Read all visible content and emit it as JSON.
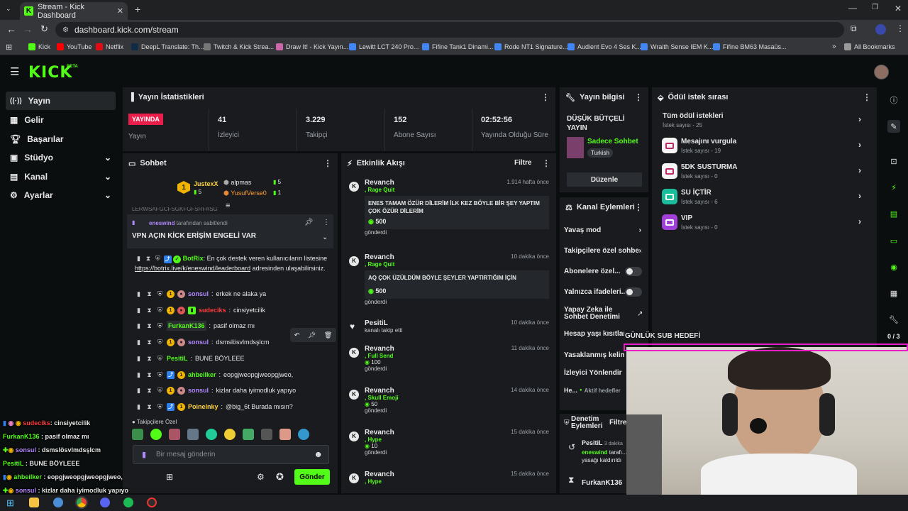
{
  "browser": {
    "tab_title": "Stream - Kick Dashboard",
    "url": "dashboard.kick.com/stream",
    "bookmarks": [
      "Kick",
      "YouTube",
      "Netflix",
      "DeepL Translate: Th...",
      "Twitch & Kick Strea...",
      "Draw It! - Kick Yayın...",
      "Lewitt LCT 240 Pro...",
      "Fifine Tank1 Dinami...",
      "Rode NT1 Signature...",
      "Audient Evo 4 Ses K...",
      "Wraith Sense IEM K...",
      "Fifine BM63 Masaüs..."
    ],
    "all_bookmarks": "All Bookmarks"
  },
  "brand": {
    "logo": "KICK",
    "beta": "BETA"
  },
  "sidebar": {
    "items": [
      {
        "label": "Yayın",
        "icon": "broadcast-icon"
      },
      {
        "label": "Gelir",
        "icon": "revenue-icon"
      },
      {
        "label": "Başarılar",
        "icon": "trophy-icon"
      },
      {
        "label": "Stüdyo",
        "icon": "studio-icon"
      },
      {
        "label": "Kanal",
        "icon": "channel-icon"
      },
      {
        "label": "Ayarlar",
        "icon": "settings-icon"
      }
    ]
  },
  "stats": {
    "title": "Yayın İstatistikleri",
    "live_badge": "YAYINDA",
    "live_label": "Yayın",
    "items": [
      {
        "value": "41",
        "label": "İzleyici"
      },
      {
        "value": "3.229",
        "label": "Takipçi"
      },
      {
        "value": "152",
        "label": "Abone Sayısı"
      },
      {
        "value": "02:52:56",
        "label": "Yayında Olduğu Süre"
      }
    ]
  },
  "stream_info": {
    "title": "Yayın bilgisi",
    "stream_title": "DÜŞÜK BÜTÇELİ YAYIN",
    "category": "Sadece Sohbet",
    "language": "Turkish",
    "edit": "Düzenle"
  },
  "channel_actions": {
    "title": "Kanal Eylemleri",
    "items": [
      "Yavaş mod",
      "Takipçilere özel sohbet",
      "Abonelere özel...",
      "Yalnızca ifadeleri...",
      "Yapay Zeka ile Sohbet Denetimi",
      "Hesap yaşı kısıtlaması",
      "Yasaklanmış kelimeler",
      "İzleyici Yönlendir",
      "He..."
    ],
    "active_hosts": "Aktif hedefler"
  },
  "moderation": {
    "title": "Denetim Eylemleri",
    "filter": "Filtre",
    "rows": [
      {
        "user": "PesitiL",
        "time": "3 dakika",
        "by": "eneswind",
        "text": "tarafı...",
        "sub": "yasağı kaldırıldı"
      },
      {
        "user": "FurkanK136",
        "time": "",
        "by": "",
        "text": "",
        "sub": ""
      }
    ]
  },
  "rewards": {
    "title": "Ödül istek sırası",
    "all": {
      "title": "Tüm ödül istekleri",
      "count": "İstek sayısı - 25"
    },
    "items": [
      {
        "title": "Mesajını vurgula",
        "count": "İstek sayısı - 19",
        "color": "#f5f5f5",
        "fg": "#c0286a"
      },
      {
        "title": "5DK SUSTURMA",
        "count": "İstek sayısı - 0",
        "color": "#f5f5f5",
        "fg": "#c0286a"
      },
      {
        "title": "SU İÇTİR",
        "count": "İstek sayısı - 6",
        "color": "#1abc9c",
        "fg": "#ffffff"
      },
      {
        "title": "VIP",
        "count": "İstek sayısı - 0",
        "color": "#a040d8",
        "fg": "#ffffff"
      }
    ]
  },
  "chat": {
    "title": "Sohbet",
    "top_gifters": [
      {
        "name": "JustexX",
        "count": "5",
        "rank": "1"
      },
      {
        "name": "alpmas",
        "count": "5"
      },
      {
        "name": "YusufVerse0",
        "count": "1"
      }
    ],
    "pinned_by": "eneswind",
    "pinned_by_suffix": "tarafından sabitlendi",
    "pinned_text": "VPN AÇIN KİCK ERİŞİM ENGELİ VAR",
    "scroll_text": "LERWSAFGCFSGKFGFSRFASG",
    "bot_user": "BotRix",
    "bot_text": "En çok destek veren kullanıcıların listesine",
    "bot_link": "https://botrix.live/k/eneswind/leaderboard",
    "bot_tail": "adresinden ulaşabilirsiniz.",
    "messages": [
      {
        "user": "sonsul",
        "text": "erkek ne alaka ya",
        "color": "#b388ff"
      },
      {
        "user": "sudeciks",
        "text": "cinsiyetcilik",
        "color": "#ff3b3b"
      },
      {
        "user": "FurkanK136",
        "text": "pasif olmaz mı",
        "color": "#53fc18"
      },
      {
        "user": "sonsul",
        "text": "dsmslösvlmdsşlcm",
        "color": "#b388ff"
      },
      {
        "user": "PesitiL",
        "text": "BUNE BÖYLEEE",
        "color": "#53fc18"
      },
      {
        "user": "ahbeilker",
        "text": "eopgjweopgjweopgjweo,",
        "color": "#53fc18"
      },
      {
        "user": "sonsul",
        "text": "kizlar daha iyimodluk yapıyo",
        "color": "#b388ff"
      },
      {
        "user": "Poinelnky",
        "text": "@big_6t Burada mısın?",
        "color": "#ffd23f"
      }
    ],
    "followers_only": "Takipçilere Özel",
    "placeholder": "Bir mesaj gönderin",
    "send": "Gönder"
  },
  "activity": {
    "title": "Etkinlik Akışı",
    "filter": "Filtre",
    "items": [
      {
        "user": "Revanch",
        "time": "1.914 hafta önce",
        "sub": ", Rage Quit",
        "msg": "ENES TAMAM ÖZÜR DİLERİM İLK KEZ BÖYLE BİR ŞEY YAPTIM ÇOK ÖZÜR DİLERİM",
        "amount": "500",
        "sent": "gönderdi"
      },
      {
        "user": "Revanch",
        "time": "10 dakika önce",
        "sub": ", Rage Quit",
        "msg": "AQ ÇOK ÜZÜLDÜM BÖYLE ŞEYLER YAPTIRTIĞIM İÇİN",
        "amount": "500",
        "sent": "gönderdi"
      },
      {
        "user": "PesitiL",
        "time": "10 dakika önce",
        "sub": "kanalı takip etti"
      },
      {
        "user": "Revanch",
        "time": "11 dakika önce",
        "sub": ", Full Send",
        "amount": "100",
        "sent": "gönderdi"
      },
      {
        "user": "Revanch",
        "time": "14 dakika önce",
        "sub": ", Skull Emoji",
        "amount": "50",
        "sent": "gönderdi"
      },
      {
        "user": "Revanch",
        "time": "15 dakika önce",
        "sub": ", Hype",
        "amount": "10",
        "sent": "gönderdi"
      },
      {
        "user": "Revanch",
        "time": "15 dakika önce",
        "sub": ", Hype"
      }
    ]
  },
  "overlay": {
    "goal": "GÜNLÜK SUB HEDEFİ",
    "goal_count": "0 / 3",
    "chat": [
      {
        "user": "sudeciks",
        "text": ": cinsiyetcilik",
        "color": "#ff3b3b"
      },
      {
        "user": "FurkanK136",
        "text": ": pasif olmaz mı",
        "color": "#53fc18"
      },
      {
        "user": "sonsul",
        "text": ": dsmslösvlmdsşlcm",
        "color": "#b388ff"
      },
      {
        "user": "PesitiL",
        "text": ": BUNE BÖYLEEE",
        "color": "#53fc18"
      },
      {
        "user": "ahbeilker",
        "text": ": eopgjweopgjweopgjweo,",
        "color": "#53fc18"
      },
      {
        "user": "sonsul",
        "text": ": kizlar daha iyimodluk yapıyo",
        "color": "#b388ff"
      }
    ]
  },
  "colors": {
    "accent": "#53fc18",
    "panel": "#191b1f",
    "bg": "#0b0e0f",
    "live": "#e91e4b"
  }
}
